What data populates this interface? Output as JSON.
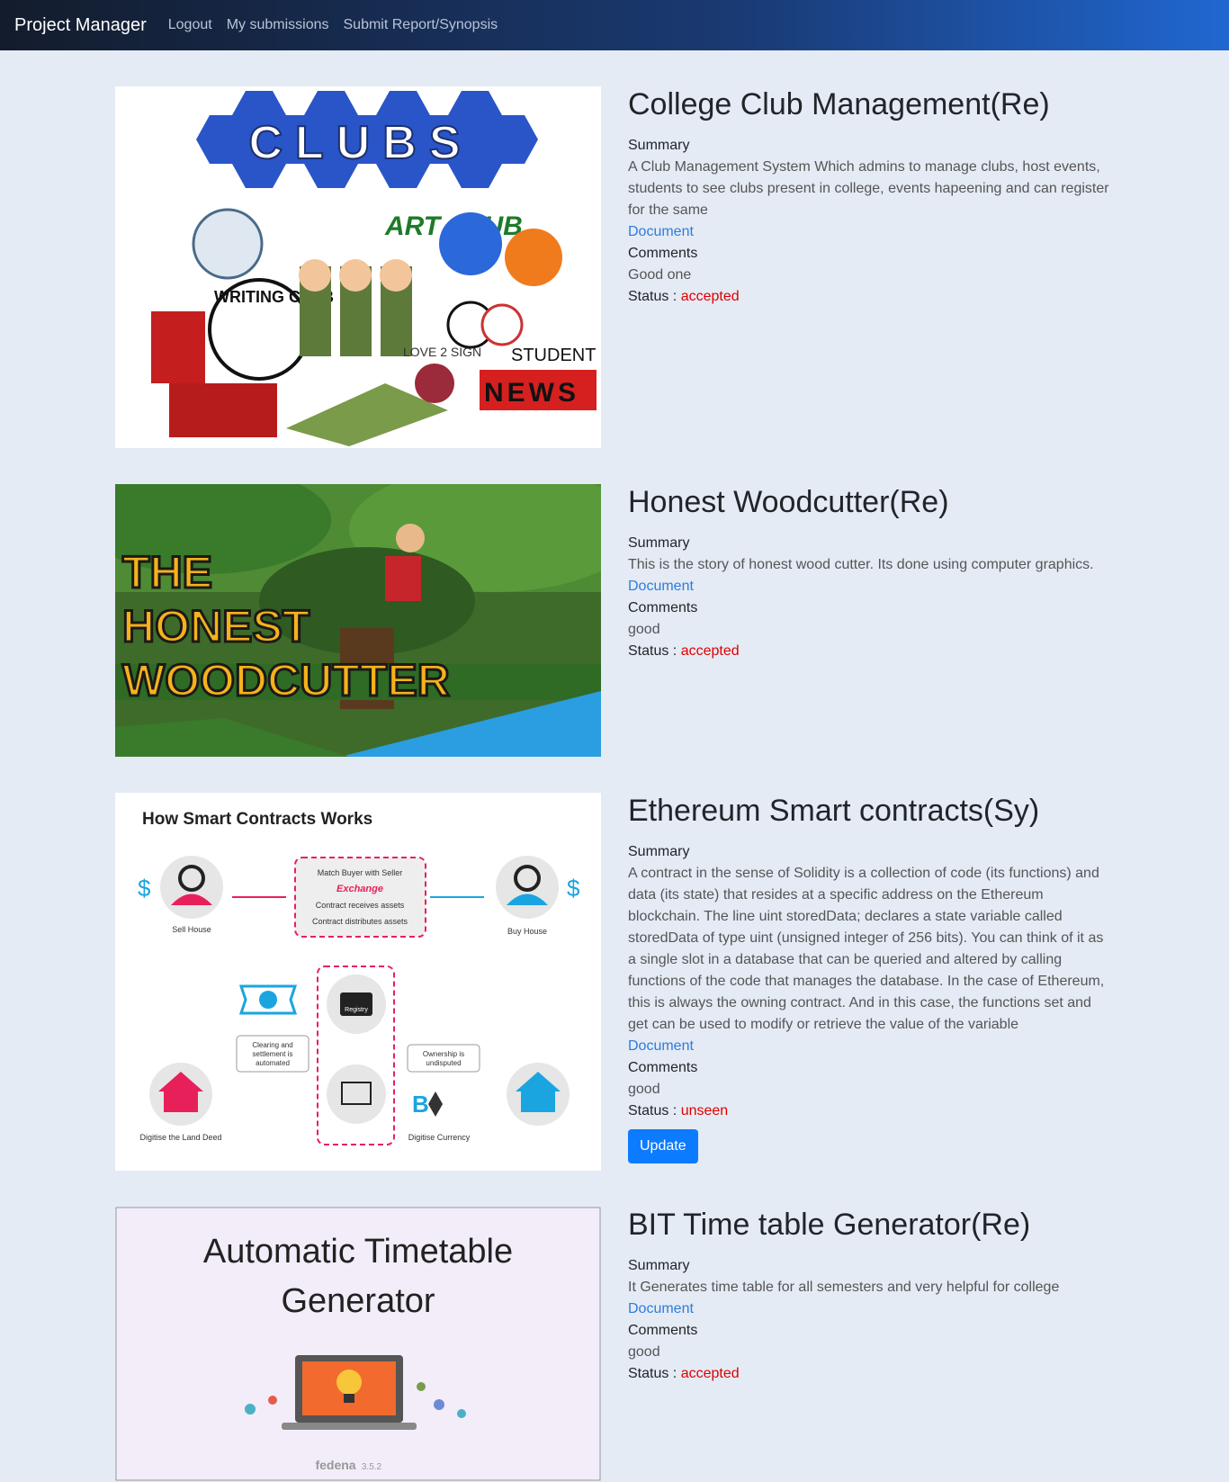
{
  "nav": {
    "brand": "Project Manager",
    "links": [
      "Logout",
      "My submissions",
      "Submit Report/Synopsis"
    ]
  },
  "projects": [
    {
      "title": "College Club Management(Re)",
      "summary_label": "Summary",
      "summary": "A Club Management System Which admins to manage clubs, host events, students to see clubs present in college, events hapeening and can register for the same",
      "document": "Document",
      "comments_label": "Comments",
      "comments": "Good one",
      "status_label": "Status :",
      "status": "accepted",
      "image_text": {
        "clubs": "CLUBS",
        "art": "ART CLUB",
        "writing": "WRITING CLUB",
        "student": "STUDENT",
        "news": "NEWS",
        "love": "LOVE 2 SIGN"
      }
    },
    {
      "title": "Honest Woodcutter(Re)",
      "summary_label": "Summary",
      "summary": "This is the story of honest wood cutter. Its done using computer graphics.",
      "document": "Document",
      "comments_label": "Comments",
      "comments": "good",
      "status_label": "Status :",
      "status": "accepted",
      "image_text": {
        "line1": "THE",
        "line2": "HONEST",
        "line3": "WOODCUTTER"
      }
    },
    {
      "title": "Ethereum Smart contracts(Sy)",
      "summary_label": "Summary",
      "summary": "A contract in the sense of Solidity is a collection of code (its functions) and data (its state) that resides at a specific address on the Ethereum blockchain. The line uint storedData; declares a state variable called storedData of type uint (unsigned integer of 256 bits). You can think of it as a single slot in a database that can be queried and altered by calling functions of the code that manages the database. In the case of Ethereum, this is always the owning contract. And in this case, the functions set and get can be used to modify or retrieve the value of the variable",
      "document": "Document",
      "comments_label": "Comments",
      "comments": "good",
      "status_label": "Status :",
      "status": "unseen",
      "update_label": "Update",
      "image_text": {
        "heading": "How Smart Contracts Works",
        "match": "Match Buyer with Seller",
        "exchange": "Exchange",
        "receives": "Contract receives assets",
        "distributes": "Contract distributes assets",
        "sell": "Sell House",
        "buy": "Buy House",
        "registry": "Registry",
        "clearing": "Clearing and settlement is automated",
        "ownership": "Ownership is undisputed",
        "deed": "Digitise the Land Deed",
        "currency": "Digitise Currency"
      }
    },
    {
      "title": "BIT Time table Generator(Re)",
      "summary_label": "Summary",
      "summary": "It Generates time table for all semesters and very helpful for college",
      "document": "Document",
      "comments_label": "Comments",
      "comments": "good",
      "status_label": "Status :",
      "status": "accepted",
      "image_text": {
        "line1": "Automatic Timetable",
        "line2": "Generator",
        "brand": "fedena",
        "version": "3.5.2"
      }
    }
  ]
}
